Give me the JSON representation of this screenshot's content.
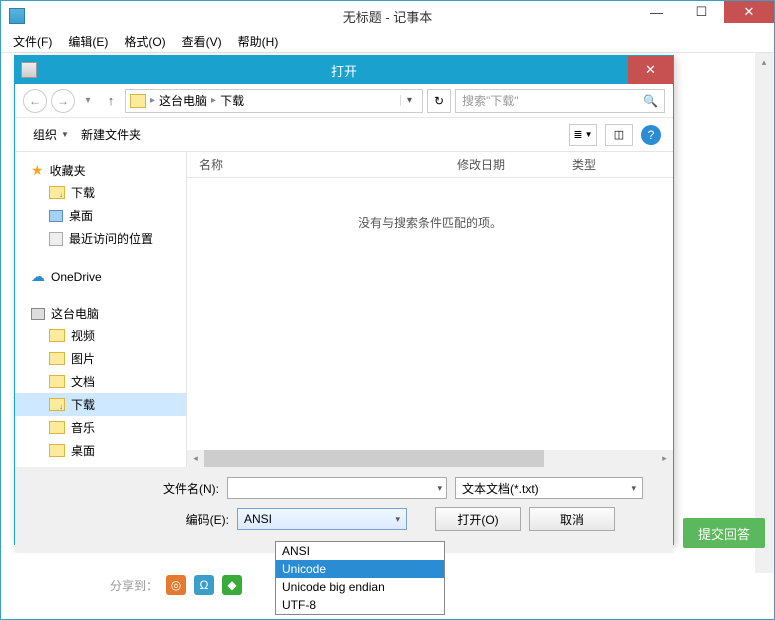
{
  "notepad": {
    "title": "无标题 - 记事本",
    "menu": {
      "file": "文件(F)",
      "edit": "编辑(E)",
      "format": "格式(O)",
      "view": "查看(V)",
      "help": "帮助(H)"
    }
  },
  "dialog": {
    "title": "打开",
    "breadcrumb": {
      "root": "这台电脑",
      "current": "下载"
    },
    "search_placeholder": "搜索\"下载\"",
    "toolbar": {
      "organize": "组织",
      "new_folder": "新建文件夹"
    },
    "columns": {
      "name": "名称",
      "date": "修改日期",
      "type": "类型"
    },
    "empty_message": "没有与搜索条件匹配的项。",
    "tree": {
      "favorites": "收藏夹",
      "downloads": "下载",
      "desktop": "桌面",
      "recent": "最近访问的位置",
      "onedrive": "OneDrive",
      "this_pc": "这台电脑",
      "videos": "视频",
      "pictures": "图片",
      "documents": "文档",
      "music": "音乐",
      "desktop2": "桌面"
    },
    "labels": {
      "filename": "文件名(N):",
      "encoding": "编码(E):"
    },
    "filetype": "文本文档(*.txt)",
    "encoding_value": "ANSI",
    "buttons": {
      "open": "打开(O)",
      "cancel": "取消"
    },
    "encoding_options": {
      "ansi": "ANSI",
      "unicode": "Unicode",
      "unicode_be": "Unicode big endian",
      "utf8": "UTF-8"
    }
  },
  "background": {
    "share_label": "分享到：",
    "submit": "提交回答"
  }
}
